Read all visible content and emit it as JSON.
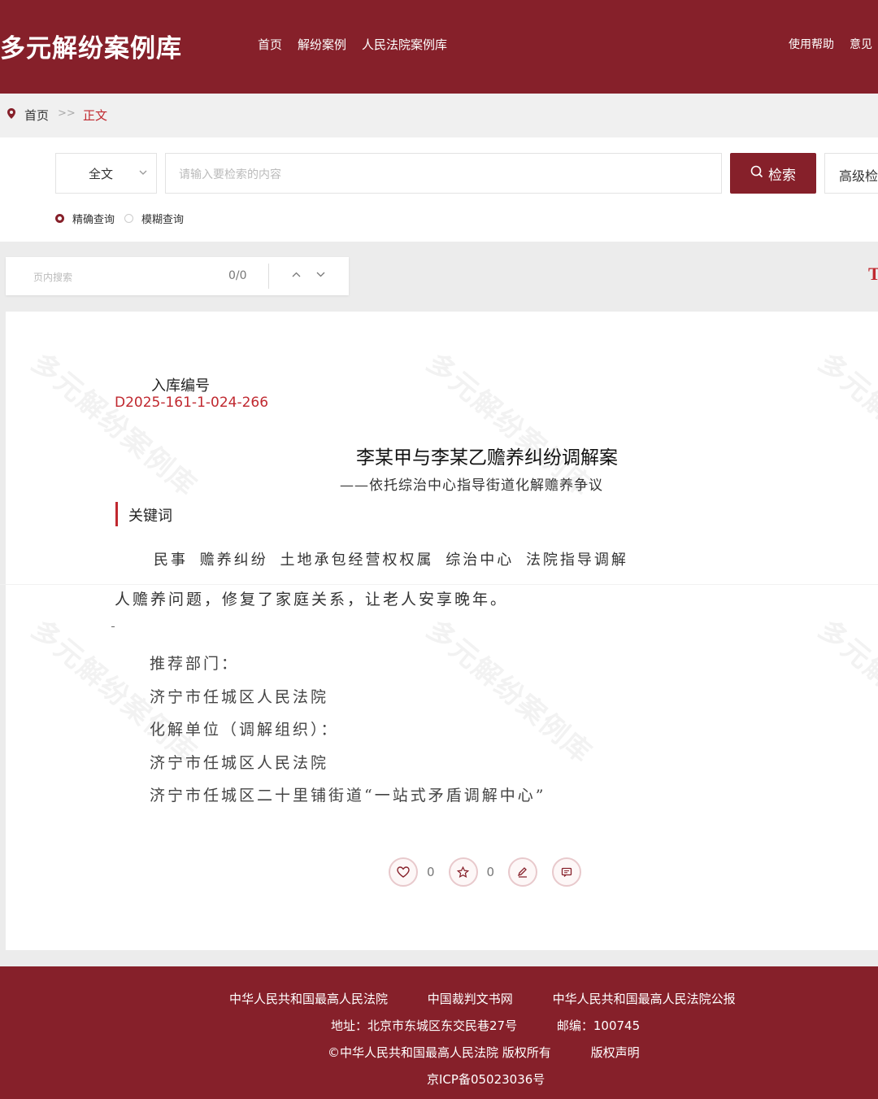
{
  "header": {
    "logo": "多元解纷案例库",
    "nav": [
      "首页",
      "解纷案例",
      "人民法院案例库"
    ],
    "nav_right": [
      "使用帮助",
      "意见"
    ]
  },
  "breadcrumb": {
    "home": "首页",
    "separator": ">>",
    "current": "正文"
  },
  "search": {
    "scope": "全文",
    "placeholder": "请输入要检索的内容",
    "search_label": "检索",
    "advanced_label": "高级检",
    "modes": [
      "精确查询",
      "模糊查询"
    ],
    "selected_mode": "精确查询"
  },
  "page_search": {
    "placeholder": "页内搜索",
    "count": "0/0"
  },
  "edge_mark": "T",
  "watermark": "多元解纷案例库",
  "case": {
    "number_label": "入库编号",
    "number": "D2025-161-1-024-266",
    "title": "李某甲与李某乙赡养纠纷调解案",
    "subtitle": "——依托综治中心指导街道化解赡养争议",
    "keywords_heading": "关键词",
    "keywords": [
      "民事",
      "赡养纠纷",
      "土地承包经营权权属",
      "综治中心",
      "法院指导调解"
    ],
    "fragment": "人赡养问题，修复了家庭关系，让老人安享晚年。",
    "recommend_label": "推荐部门：",
    "recommend_value": "济宁市任城区人民法院",
    "resolve_label": "化解单位（调解组织）：",
    "resolve_values": [
      "济宁市任城区人民法院",
      "济宁市任城区二十里铺街道“一站式矛盾调解中心”"
    ]
  },
  "actions": {
    "like_count": "0",
    "favorite_count": "0"
  },
  "footer": {
    "links": [
      "中华人民共和国最高人民法院",
      "中国裁判文书网",
      "中华人民共和国最高人民法院公报"
    ],
    "address": "地址：北京市东城区东交民巷27号",
    "postcode": "邮编：100745",
    "copyright": "©中华人民共和国最高人民法院 版权所有",
    "copyright_statement": "版权声明",
    "icp": "京ICP备05023036号"
  }
}
